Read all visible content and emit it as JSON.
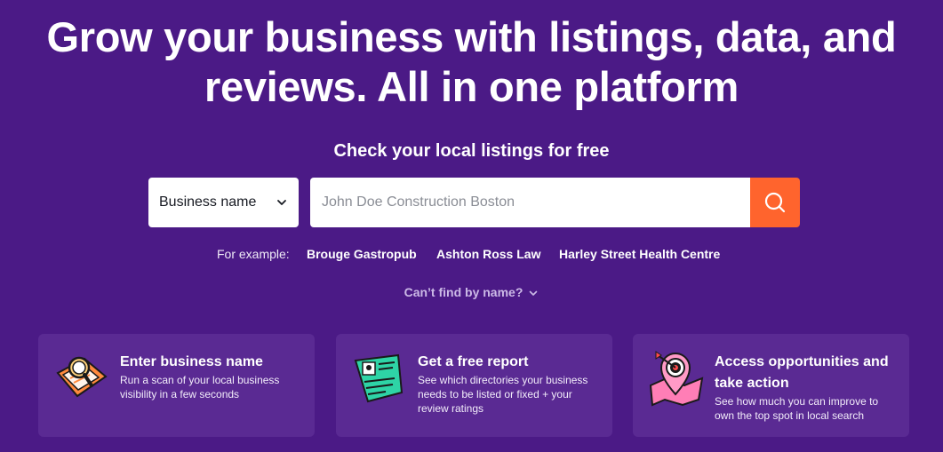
{
  "hero": {
    "title_line1": "Grow your business with listings, data, and",
    "title_line2": "reviews. All in one platform",
    "subtitle": "Check your local listings for free"
  },
  "search": {
    "select_value": "Business name",
    "placeholder": "John Doe Construction Boston",
    "button_icon": "search-icon"
  },
  "examples": {
    "label": "For example:",
    "items": [
      "Brouge Gastropub",
      "Ashton Ross Law",
      "Harley Street Health Centre"
    ]
  },
  "cant_find": "Can’t find by name?",
  "cards": [
    {
      "title": "Enter business name",
      "text": "Run a scan of your local business visibility in a few seconds",
      "icon": "magnifier-illustration-icon"
    },
    {
      "title": "Get a free report",
      "text": "See which directories your business needs to be listed or fixed + your review ratings",
      "icon": "report-illustration-icon"
    },
    {
      "title": "Access opportunities and take action",
      "text": "See how much you can improve to own the top spot in local search",
      "icon": "target-map-illustration-icon"
    }
  ],
  "colors": {
    "background": "#4b1a86",
    "card": "#5a2a93",
    "accent": "#ff642d"
  }
}
